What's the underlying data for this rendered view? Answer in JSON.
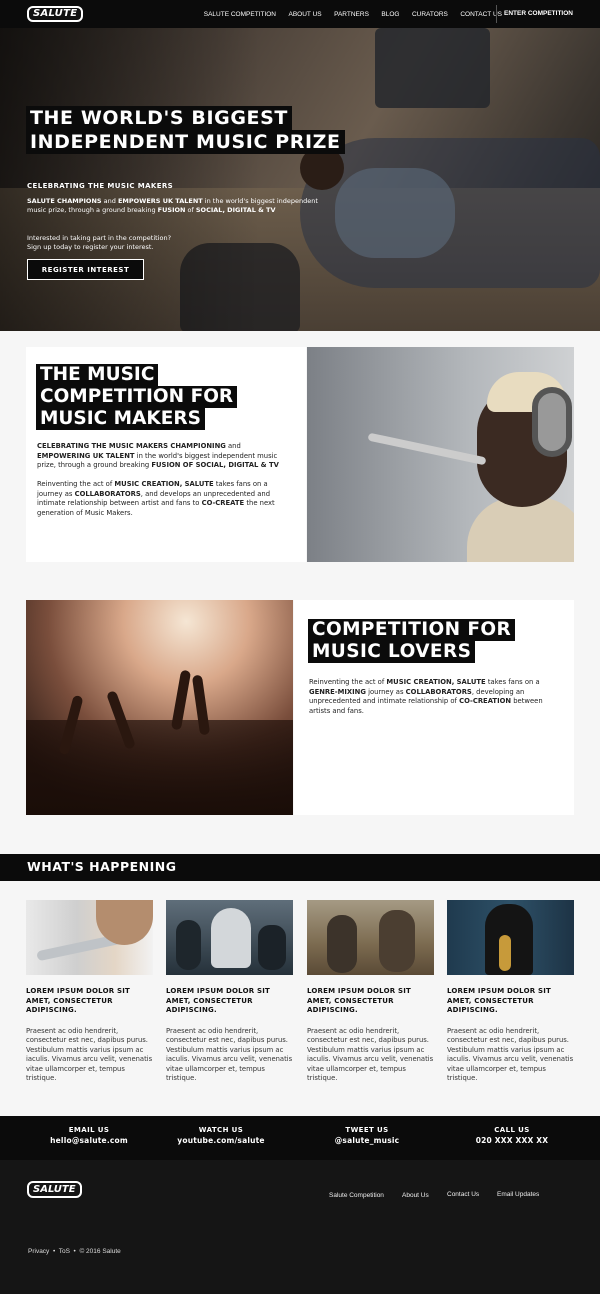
{
  "nav": {
    "logo": "SALUTE",
    "links": [
      "SALUTE COMPETITION",
      "ABOUT US",
      "PARTNERS",
      "BLOG",
      "CURATORS",
      "CONTACT US"
    ],
    "cta": "ENTER COMPETITION"
  },
  "hero": {
    "title_line1": "THE WORLD'S BIGGEST",
    "title_line2": "INDEPENDENT MUSIC PRIZE",
    "subtitle": "CELEBRATING THE MUSIC MAKERS",
    "body": {
      "b1": "SALUTE CHAMPIONS",
      "t1": " and ",
      "b2": "EMPOWERS UK TALENT",
      "t2": " in the world's biggest independent music prize, through a ground breaking ",
      "b3": "FUSION",
      "t3": " of ",
      "b4": "SOCIAL, DIGITAL & TV"
    },
    "ask_line1": "Interested in taking part in the competition?",
    "ask_line2": "Sign up today to register your interest.",
    "button": "REGISTER INTEREST"
  },
  "makers": {
    "title_line1": "THE MUSIC",
    "title_line2": "COMPETITION FOR",
    "title_line3": "MUSIC MAKERS",
    "p1": {
      "b1": "CELEBRATING THE MUSIC MAKERS CHAMPIONING",
      "t1": " and ",
      "b2": "EMPOWERING UK TALENT",
      "t2": " in the world's biggest independent music prize, through a ground breaking ",
      "b3": "FUSION OF SOCIAL, DIGITAL & TV"
    },
    "p2": {
      "t1": "Reinventing the act of ",
      "b1": "MUSIC CREATION, SALUTE",
      "t2": " takes fans on a journey as ",
      "b2": "COLLABORATORS",
      "t3": ", and develops an unprecedented and intimate relationship between artist and fans to ",
      "b3": "CO-CREATE",
      "t4": " the next generation of Music Makers."
    }
  },
  "lovers": {
    "title_line1": "COMPETITION FOR",
    "title_line2": "MUSIC LOVERS",
    "p": {
      "t1": "Reinventing the act of ",
      "b1": "MUSIC CREATION, SALUTE",
      "t2": " takes fans on a ",
      "b2": "GENRE-MIXING",
      "t3": " journey as ",
      "b3": "COLLABORATORS",
      "t4": ", developing an unprecedented and intimate relationship of ",
      "b4": "CO-CREATION",
      "t5": " between artists and fans."
    }
  },
  "whats_happening": {
    "heading": "WHAT'S HAPPENING",
    "articles": [
      {
        "title": "LOREM IPSUM DOLOR SIT AMET, CONSECTETUR ADIPISCING.",
        "body": "Praesent ac odio hendrerit, consectetur est nec, dapibus purus. Vestibulum mattis varius ipsum ac iaculis. Vivamus arcu velit, venenatis vitae ullamcorper et, tempus tristique."
      },
      {
        "title": "LOREM IPSUM DOLOR SIT AMET, CONSECTETUR ADIPISCING.",
        "body": "Praesent ac odio hendrerit, consectetur est nec, dapibus purus. Vestibulum mattis varius ipsum ac iaculis. Vivamus arcu velit, venenatis vitae ullamcorper et, tempus tristique."
      },
      {
        "title": "LOREM IPSUM DOLOR SIT AMET, CONSECTETUR ADIPISCING.",
        "body": "Praesent ac odio hendrerit, consectetur est nec, dapibus purus. Vestibulum mattis varius ipsum ac iaculis. Vivamus arcu velit, venenatis vitae ullamcorper et, tempus tristique."
      },
      {
        "title": "LOREM IPSUM DOLOR SIT AMET, CONSECTETUR ADIPISCING.",
        "body": "Praesent ac odio hendrerit, consectetur est nec, dapibus purus. Vestibulum mattis varius ipsum ac iaculis. Vivamus arcu velit, venenatis vitae ullamcorper et, tempus tristique."
      }
    ]
  },
  "contact": [
    {
      "label": "EMAIL US",
      "value": "hello@salute.com"
    },
    {
      "label": "WATCH US",
      "value": "youtube.com/salute"
    },
    {
      "label": "TWEET US",
      "value": "@salute_music"
    },
    {
      "label": "CALL US",
      "value": "020 XXX XXX XX"
    }
  ],
  "footer": {
    "logo": "SALUTE",
    "links": [
      "Salute Competition",
      "About Us",
      "Contact Us",
      "Email Updates"
    ],
    "privacy": "Privacy",
    "tos": "ToS",
    "copyright": "© 2016 Salute",
    "sep": "•"
  }
}
